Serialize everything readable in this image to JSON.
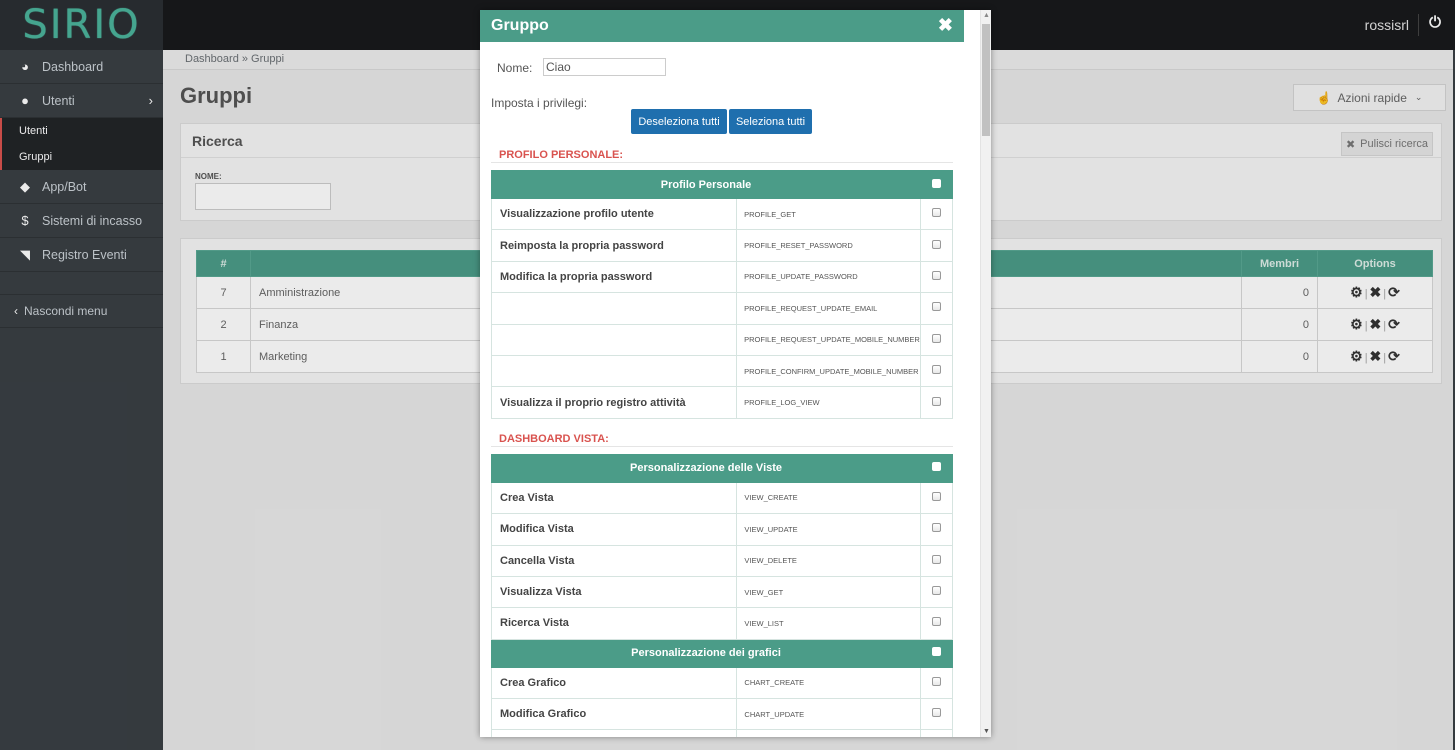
{
  "app": {
    "logo": "SIRIO",
    "user": "rossisrl"
  },
  "sidebar": {
    "items": [
      {
        "label": "Dashboard"
      },
      {
        "label": "Utenti"
      }
    ],
    "sub_items": [
      {
        "label": "Utenti"
      },
      {
        "label": "Gruppi"
      }
    ],
    "items2": [
      {
        "label": "App/Bot"
      },
      {
        "label": "Sistemi di incasso"
      },
      {
        "label": "Registro Eventi"
      }
    ],
    "hide_menu": "Nascondi menu"
  },
  "main": {
    "breadcrumb": "Dashboard » Gruppi",
    "title": "Gruppi",
    "quick_actions": "Azioni rapide",
    "search": {
      "title": "Ricerca",
      "clear": "Pulisci ricerca",
      "name_label": "NOME:"
    },
    "table": {
      "headers": {
        "num": "#",
        "members": "Membri",
        "options": "Options"
      },
      "rows": [
        {
          "num": "7",
          "name": "Amministrazione",
          "members": "0"
        },
        {
          "num": "2",
          "name": "Finanza",
          "members": "0"
        },
        {
          "num": "1",
          "name": "Marketing",
          "members": "0"
        }
      ]
    }
  },
  "modal": {
    "title": "Gruppo",
    "nome_label": "Nome:",
    "nome_value": "Ciao",
    "priv_label": "Imposta i privilegi:",
    "deselect_all": "Deseleziona tutti",
    "select_all": "Seleziona tutti",
    "sections": [
      {
        "title": "PROFILO PERSONALE:",
        "groups": [
          {
            "header": "Profilo Personale",
            "rows": [
              {
                "label": "Visualizzazione profilo utente",
                "code": "PROFILE_GET"
              },
              {
                "label": "Reimposta la propria password",
                "code": "PROFILE_RESET_PASSWORD"
              },
              {
                "label": "Modifica la propria password",
                "code": "PROFILE_UPDATE_PASSWORD"
              },
              {
                "label": "",
                "code": "PROFILE_REQUEST_UPDATE_EMAIL"
              },
              {
                "label": "",
                "code": "PROFILE_REQUEST_UPDATE_MOBILE_NUMBER"
              },
              {
                "label": "",
                "code": "PROFILE_CONFIRM_UPDATE_MOBILE_NUMBER"
              },
              {
                "label": "Visualizza il proprio registro attività",
                "code": "PROFILE_LOG_VIEW"
              }
            ]
          }
        ]
      },
      {
        "title": "DASHBOARD VISTA:",
        "groups": [
          {
            "header": "Personalizzazione delle Viste",
            "rows": [
              {
                "label": "Crea Vista",
                "code": "VIEW_CREATE"
              },
              {
                "label": "Modifica Vista",
                "code": "VIEW_UPDATE"
              },
              {
                "label": "Cancella Vista",
                "code": "VIEW_DELETE"
              },
              {
                "label": "Visualizza Vista",
                "code": "VIEW_GET"
              },
              {
                "label": "Ricerca Vista",
                "code": "VIEW_LIST"
              }
            ]
          },
          {
            "header": "Personalizzazione dei grafici",
            "rows": [
              {
                "label": "Crea Grafico",
                "code": "CHART_CREATE"
              },
              {
                "label": "Modifica Grafico",
                "code": "CHART_UPDATE"
              },
              {
                "label": "",
                "code": ""
              }
            ]
          }
        ]
      }
    ]
  }
}
